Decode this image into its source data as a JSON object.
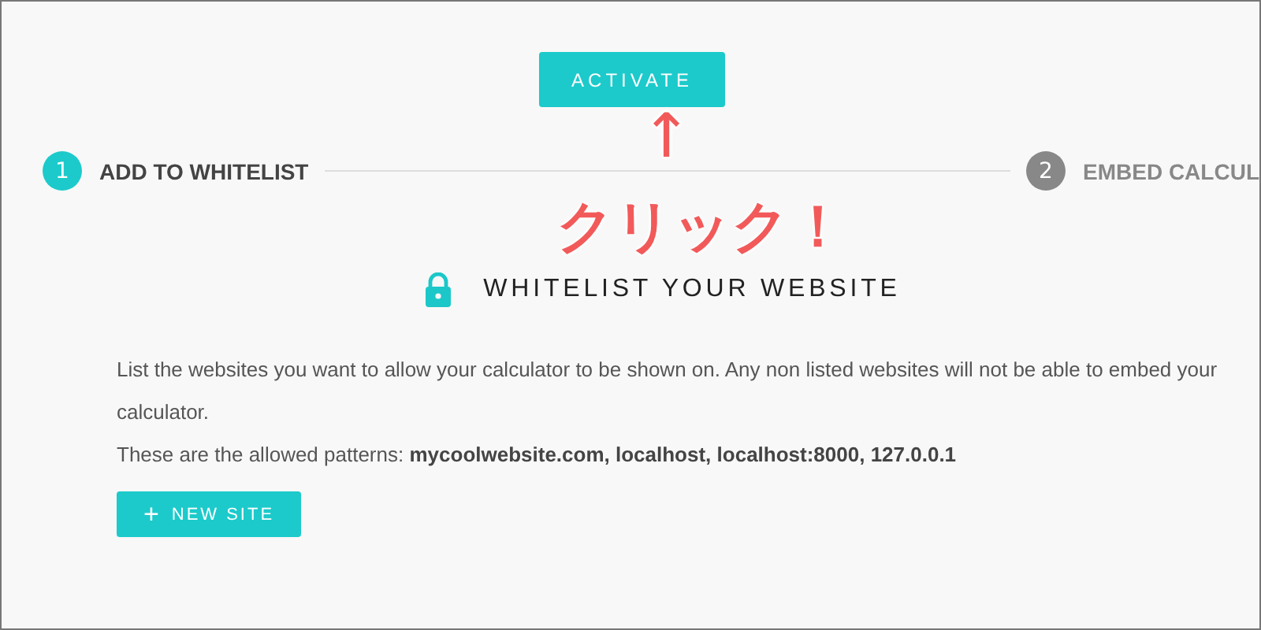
{
  "activate_button": {
    "label": "ACTIVATE"
  },
  "steps": [
    {
      "number": "1",
      "label": "ADD TO WHITELIST",
      "selected": true
    },
    {
      "number": "2",
      "label": "EMBED CALCUL",
      "selected": false
    }
  ],
  "annotation": {
    "arrow": "↑",
    "text": "クリック！"
  },
  "section": {
    "title": "WHITELIST YOUR WEBSITE",
    "description": "List the websites you want to allow your calculator to be shown on. Any non listed websites will not be able to embed your calculator.",
    "patterns": "These are the allowed patterns: **mycoolwebsite.com, localhost, localhost:8000, 127.0.0.1**",
    "new_site_button": {
      "icon": "+",
      "label": "NEW SITE"
    }
  }
}
